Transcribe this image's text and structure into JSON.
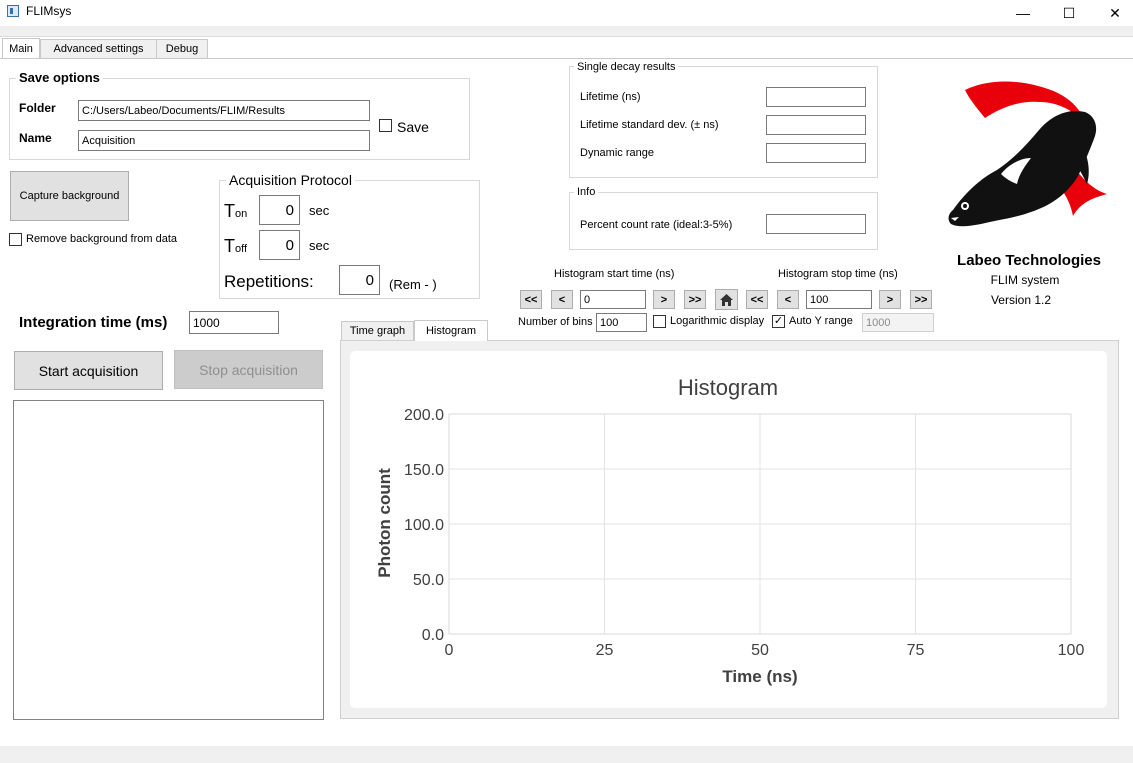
{
  "window": {
    "title": "FLIMsys",
    "minimize": "—",
    "maximize": "☐",
    "close": "✕"
  },
  "tabs": [
    {
      "label": "Main",
      "active": true
    },
    {
      "label": "Advanced settings",
      "active": false
    },
    {
      "label": "Debug",
      "active": false
    }
  ],
  "save_options": {
    "title": "Save options",
    "folder_label": "Folder",
    "folder_value": "C:/Users/Labeo/Documents/FLIM/Results",
    "name_label": "Name",
    "name_value": "Acquisition",
    "save_label": "Save",
    "save_checked": false
  },
  "background": {
    "capture_label": "Capture background",
    "remove_label": "Remove background from data",
    "remove_checked": false
  },
  "protocol": {
    "title": "Acquisition Protocol",
    "ton_main": "T",
    "ton_sub": "on",
    "ton_value": "0",
    "ton_unit": "sec",
    "toff_main": "T",
    "toff_sub": "off",
    "toff_value": "0",
    "toff_unit": "sec",
    "repetitions_label": "Repetitions:",
    "repetitions_value": "0",
    "remaining": "(Rem - )"
  },
  "integration": {
    "label": "Integration time (ms)",
    "value": "1000"
  },
  "acquisition": {
    "start_label": "Start acquisition",
    "stop_label": "Stop acquisition"
  },
  "single_decay": {
    "title": "Single decay results",
    "lifetime_label": "Lifetime (ns)",
    "lifetime_value": "",
    "std_label": "Lifetime standard dev. (± ns)",
    "std_value": "",
    "dynamic_label": "Dynamic range",
    "dynamic_value": ""
  },
  "info": {
    "title": "Info",
    "percent_label": "Percent count rate (ideal:3-5%)",
    "percent_value": ""
  },
  "brand": {
    "company": "Labeo Technologies",
    "product": "FLIM system",
    "version": "Version 1.2",
    "logo_colors": {
      "body": "#111111",
      "fins": "#e8000b"
    }
  },
  "histogram_controls": {
    "start_label": "Histogram start time (ns)",
    "start_value": "0",
    "stop_label": "Histogram stop time (ns)",
    "stop_value": "100",
    "btn_first": "<<",
    "btn_prev": "<",
    "btn_next": ">",
    "btn_last": ">>",
    "home_icon": "home-icon",
    "bins_label": "Number of bins",
    "bins_value": "100",
    "log_label": "Logarithmic display",
    "log_checked": false,
    "autoy_label": "Auto Y range",
    "autoy_checked": true,
    "autoy_value": "1000"
  },
  "graph_tabs": [
    {
      "label": "Time graph",
      "active": false
    },
    {
      "label": "Histogram",
      "active": true
    }
  ],
  "chart_data": {
    "type": "line",
    "title": "Histogram",
    "xlabel": "Time (ns)",
    "ylabel": "Photon count",
    "xlim": [
      0,
      100
    ],
    "ylim": [
      0,
      200
    ],
    "x_ticks": [
      "0",
      "25",
      "50",
      "75",
      "100"
    ],
    "x_tick_values": [
      0,
      25,
      50,
      75,
      100
    ],
    "y_ticks": [
      "0.0",
      "50.0",
      "100.0",
      "150.0",
      "200.0"
    ],
    "y_tick_values": [
      0,
      50,
      100,
      150,
      200
    ],
    "grid": true,
    "series": []
  }
}
